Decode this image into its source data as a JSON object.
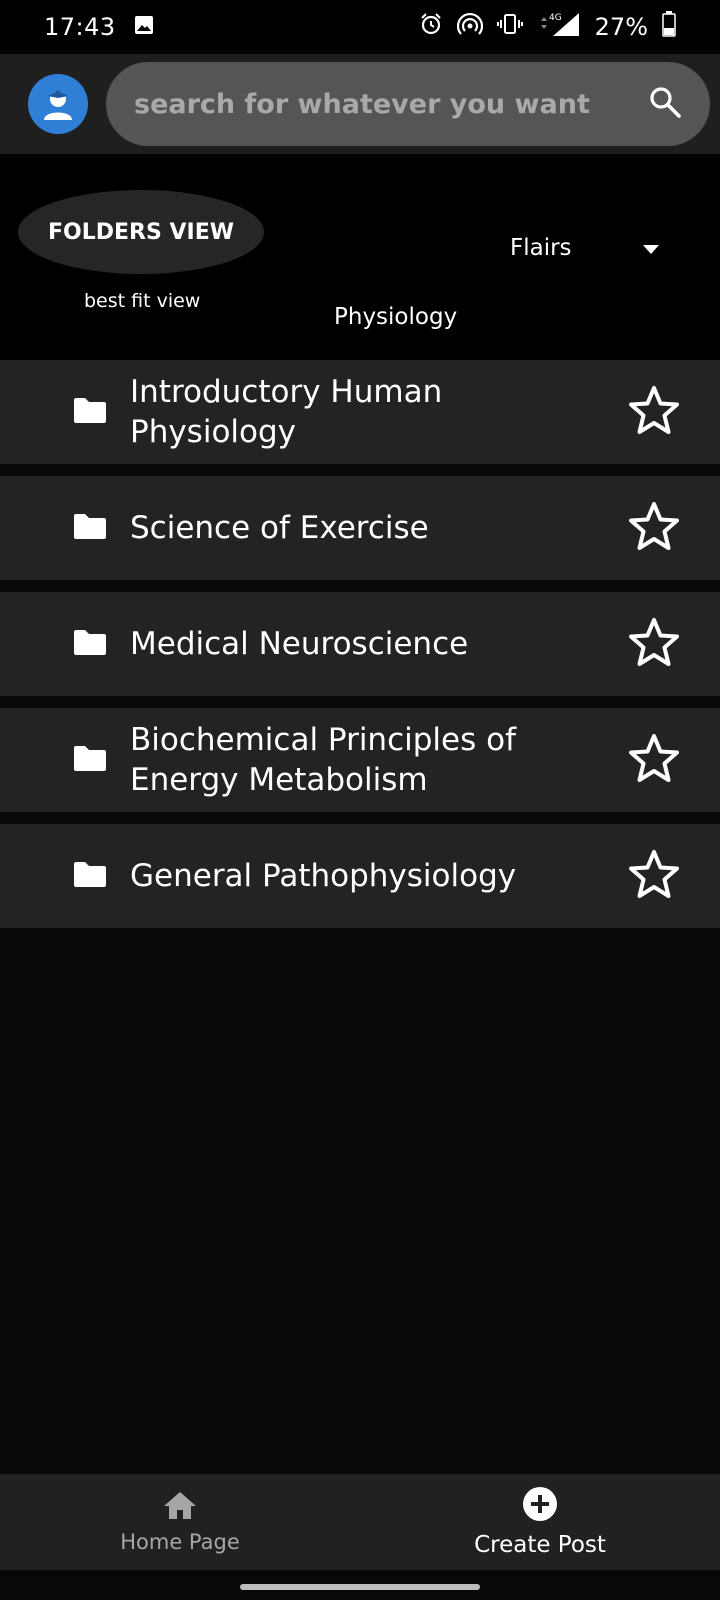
{
  "status_bar": {
    "time": "17:43",
    "battery": "27%",
    "icons": [
      "image-icon",
      "alarm-icon",
      "hotspot-icon",
      "vibrate-icon",
      "network-4g-icon",
      "signal-icon",
      "battery-icon"
    ]
  },
  "top_bar": {
    "search_placeholder": "search for whatever you want",
    "avatar_icon": "user-avatar-icon",
    "search_icon": "search-icon",
    "colors": {
      "avatar_bg": "#2f7fd6",
      "search_bg": "#555555"
    }
  },
  "controls": {
    "folders_view_label": "FOLDERS VIEW",
    "best_fit_label": "best fit view",
    "flairs_label": "Flairs",
    "selected_flair": "Physiology"
  },
  "folders": [
    {
      "name": "Introductory Human Physiology"
    },
    {
      "name": "Science of Exercise"
    },
    {
      "name": "Medical Neuroscience"
    },
    {
      "name": "Biochemical Principles of Energy Metabolism"
    },
    {
      "name": "General Pathophysiology"
    }
  ],
  "bottom_nav": {
    "home_label": "Home Page",
    "create_label": "Create Post"
  }
}
